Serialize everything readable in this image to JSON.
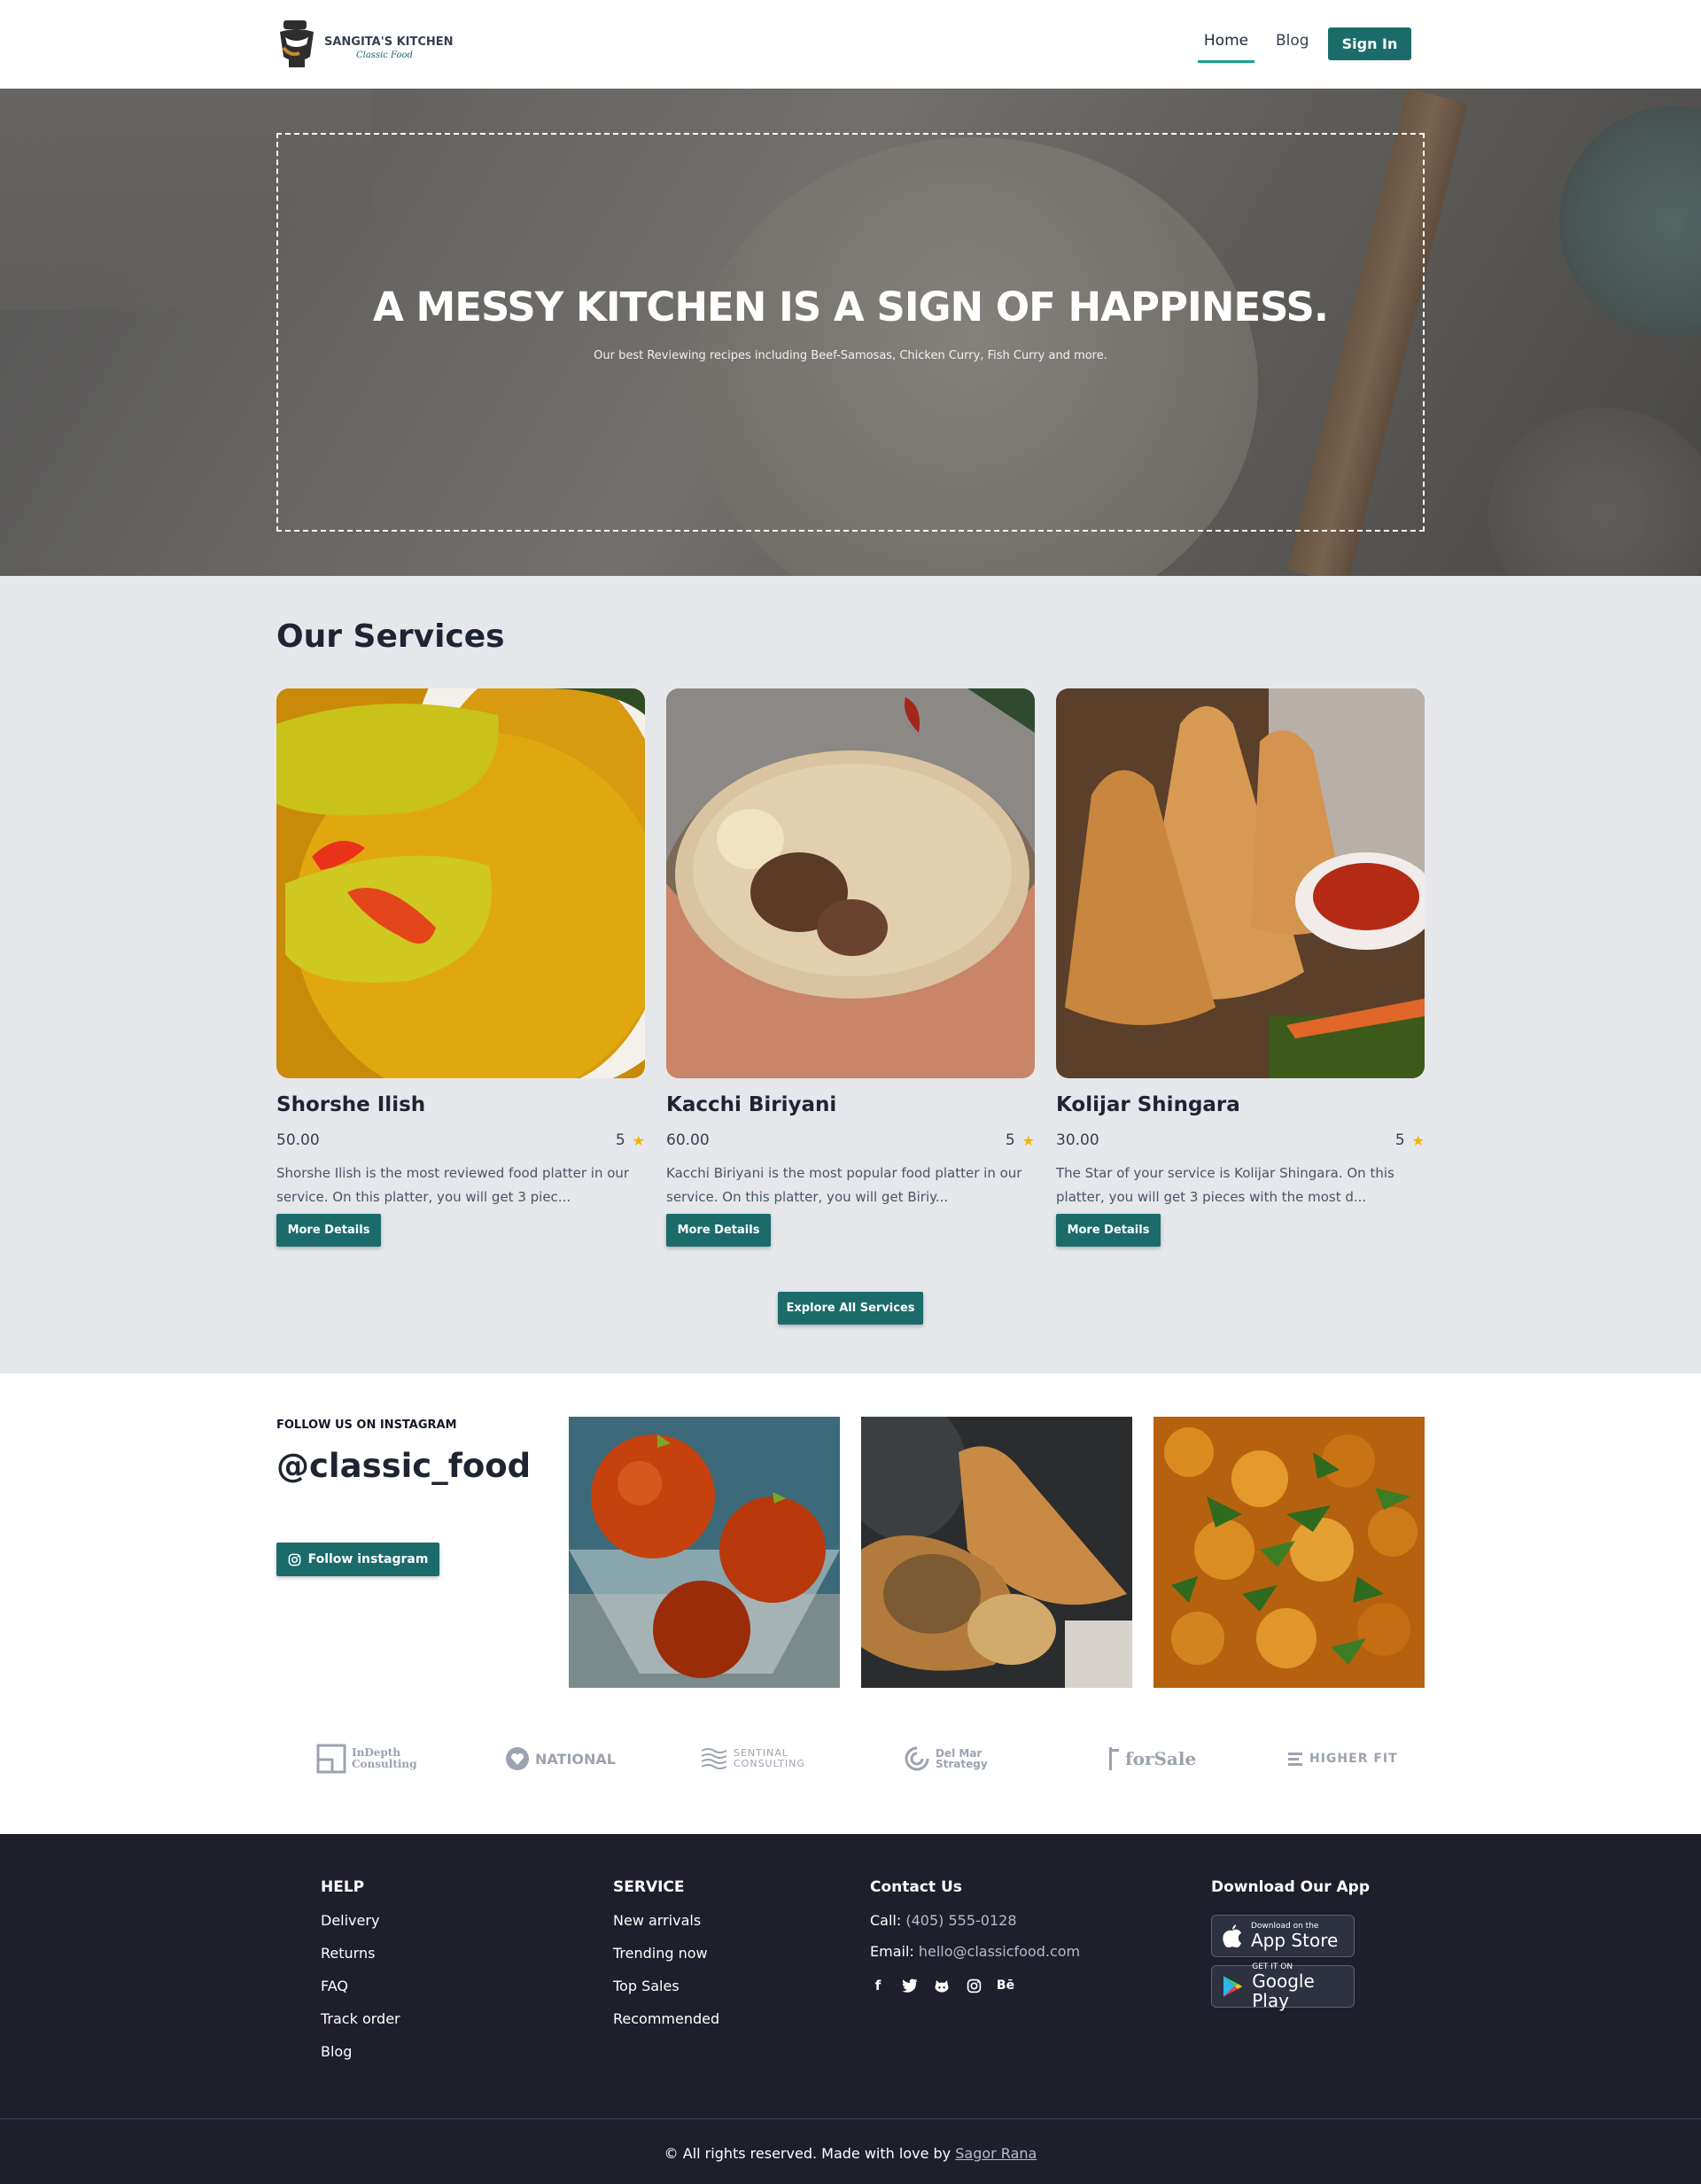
{
  "header": {
    "logo_title": "SANGITA'S KITCHEN",
    "logo_subtitle": "Classic Food",
    "nav": {
      "home": "Home",
      "blog": "Blog",
      "signin": "Sign In"
    }
  },
  "hero": {
    "title": "A MESSY KITCHEN IS A SIGN OF HAPPINESS.",
    "subtitle": "Our best Reviewing recipes including Beef-Samosas, Chicken Curry, Fish Curry and more."
  },
  "services": {
    "title": "Our Services",
    "cards": [
      {
        "name": "Shorshe Ilish",
        "price": "50.00",
        "rating": "5",
        "description": "Shorshe Ilish is the most reviewed food platter in our service. On this platter, you will get 3 piec...",
        "button": "More Details"
      },
      {
        "name": "Kacchi Biriyani",
        "price": "60.00",
        "rating": "5",
        "description": "Kacchi Biriyani is the most popular food platter in our service. On this platter, you will get Biriy...",
        "button": "More Details"
      },
      {
        "name": "Kolijar Shingara",
        "price": "30.00",
        "rating": "5",
        "description": "The Star of your service is Kolijar Shingara. On this platter, you will get 3 pieces with the most d...",
        "button": "More Details"
      }
    ],
    "explore_button": "Explore All Services"
  },
  "instagram": {
    "label": "FOLLOW US ON INSTAGRAM",
    "handle": "@classic_food",
    "button": "Follow instagram"
  },
  "brands": [
    {
      "line1": "InDepth",
      "line2": "Consulting"
    },
    {
      "line1": "NATIONAL"
    },
    {
      "line1": "SENTINAL",
      "line2": "CONSULTING"
    },
    {
      "line1": "Del Mar",
      "line2": "Strategy"
    },
    {
      "line1": "forSale"
    },
    {
      "line1": "HIGHER FIT"
    }
  ],
  "footer": {
    "help": {
      "heading": "HELP",
      "items": [
        "Delivery",
        "Returns",
        "FAQ",
        "Track order",
        "Blog"
      ]
    },
    "service": {
      "heading": "SERVICE",
      "items": [
        "New arrivals",
        "Trending now",
        "Top Sales",
        "Recommended"
      ]
    },
    "contact": {
      "heading": "Contact Us",
      "call_label": "Call:",
      "phone": "(405) 555-0128",
      "email_label": "Email:",
      "email": "hello@classicfood.com"
    },
    "app": {
      "heading": "Download Our App",
      "appstore_small": "Download on the",
      "appstore_big": "App Store",
      "googleplay_small": "GET IT ON",
      "googleplay_big": "Google Play"
    },
    "copyright_text": "© All rights reserved. Made with love by",
    "copyright_author": "Sagor Rana"
  },
  "colors": {
    "brand": "#1b6b6b",
    "accent": "#15a394",
    "footer_bg": "#1e1f2b",
    "section_bg": "#e5e7eb",
    "star": "#f5b301"
  }
}
